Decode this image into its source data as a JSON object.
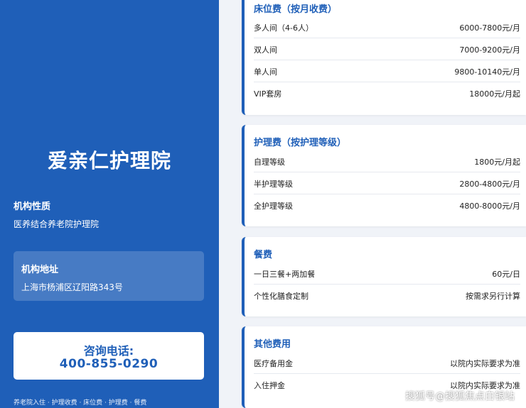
{
  "sidebar": {
    "org_name": "爱亲仁护理院",
    "nature_title": "机构性质",
    "nature_value": "医养结合养老院护理院",
    "address_title": "机构地址",
    "address_value": "上海市杨浦区辽阳路343号",
    "phone_label": "咨询电话:",
    "phone_number": "400-855-0290",
    "footer_links": "养老院入住 · 护理收费 · 床位费 · 护理费 · 餐费"
  },
  "cards": [
    {
      "title": "床位费（按月收费）",
      "rows": [
        {
          "name": "多人间（4-6人）",
          "price": "6000-7800元/月"
        },
        {
          "name": "双人间",
          "price": "7000-9200元/月"
        },
        {
          "name": "单人间",
          "price": "9800-10140元/月"
        },
        {
          "name": "VIP套房",
          "price": "18000元/月起"
        }
      ]
    },
    {
      "title": "护理费（按护理等级）",
      "rows": [
        {
          "name": "自理等级",
          "price": "1800元/月起"
        },
        {
          "name": "半护理等级",
          "price": "2800-4800元/月"
        },
        {
          "name": "全护理等级",
          "price": "4800-8000元/月"
        }
      ]
    },
    {
      "title": "餐费",
      "rows": [
        {
          "name": "一日三餐+两加餐",
          "price": "60元/日"
        },
        {
          "name": "个性化膳食定制",
          "price": "按需求另行计算"
        }
      ]
    },
    {
      "title": "其他费用",
      "rows": [
        {
          "name": "医疗备用金",
          "price": "以院内实际要求为准"
        },
        {
          "name": "入住押金",
          "price": "以院内实际要求为准"
        }
      ]
    }
  ],
  "watermark": "搜狐号@搜狐焦点白银站"
}
